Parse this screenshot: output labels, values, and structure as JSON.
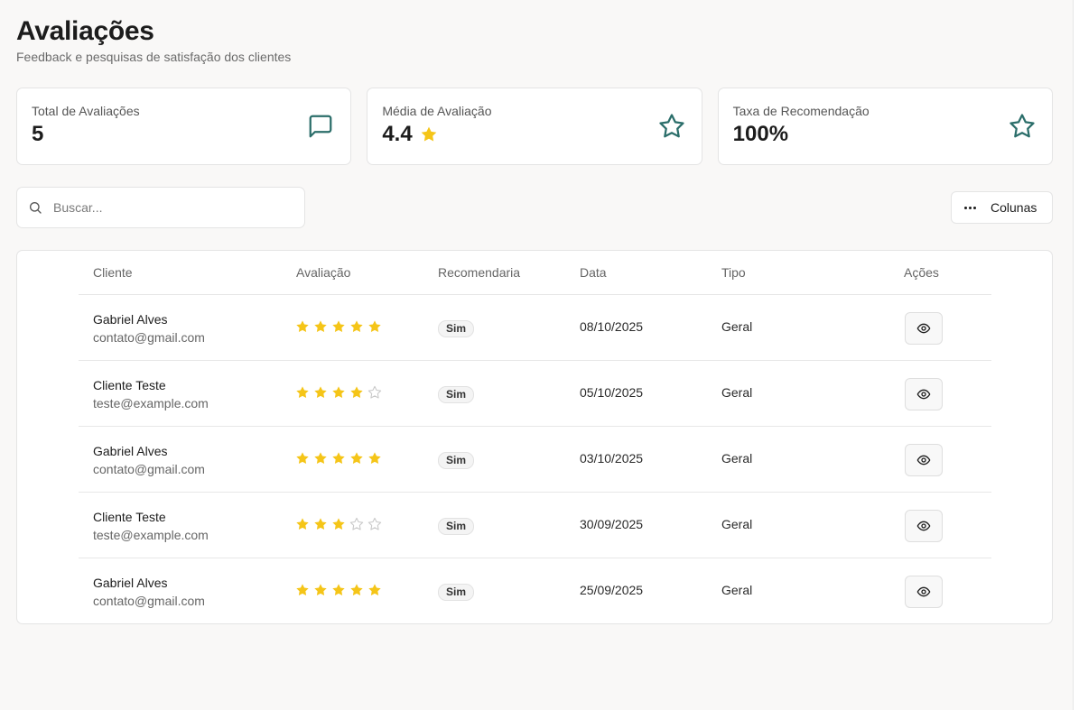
{
  "header": {
    "title": "Avaliações",
    "subtitle": "Feedback e pesquisas de satisfação dos clientes"
  },
  "stats": [
    {
      "label": "Total de Avaliações",
      "value": "5",
      "icon": "message-square-icon"
    },
    {
      "label": "Média de Avaliação",
      "value": "4.4",
      "icon": "star-outline-icon"
    },
    {
      "label": "Taxa de Recomendação",
      "value": "100%",
      "icon": "star-outline-icon"
    }
  ],
  "search": {
    "placeholder": "Buscar..."
  },
  "toolbar": {
    "columns_label": "Colunas"
  },
  "table": {
    "headers": [
      "Cliente",
      "Avaliação",
      "Recomendaria",
      "Data",
      "Tipo",
      "Ações"
    ],
    "rows": [
      {
        "name": "Gabriel Alves",
        "email": "contato@gmail.com",
        "rating": 5,
        "recommend": "Sim",
        "date": "08/10/2025",
        "type": "Geral"
      },
      {
        "name": "Cliente Teste",
        "email": "teste@example.com",
        "rating": 4,
        "recommend": "Sim",
        "date": "05/10/2025",
        "type": "Geral"
      },
      {
        "name": "Gabriel Alves",
        "email": "contato@gmail.com",
        "rating": 5,
        "recommend": "Sim",
        "date": "03/10/2025",
        "type": "Geral"
      },
      {
        "name": "Cliente Teste",
        "email": "teste@example.com",
        "rating": 3,
        "recommend": "Sim",
        "date": "30/09/2025",
        "type": "Geral"
      },
      {
        "name": "Gabriel Alves",
        "email": "contato@gmail.com",
        "rating": 5,
        "recommend": "Sim",
        "date": "25/09/2025",
        "type": "Geral"
      }
    ]
  },
  "colors": {
    "accent": "#2b6e6a",
    "star": "#f5c518",
    "star_empty": "#c9c9c9"
  }
}
